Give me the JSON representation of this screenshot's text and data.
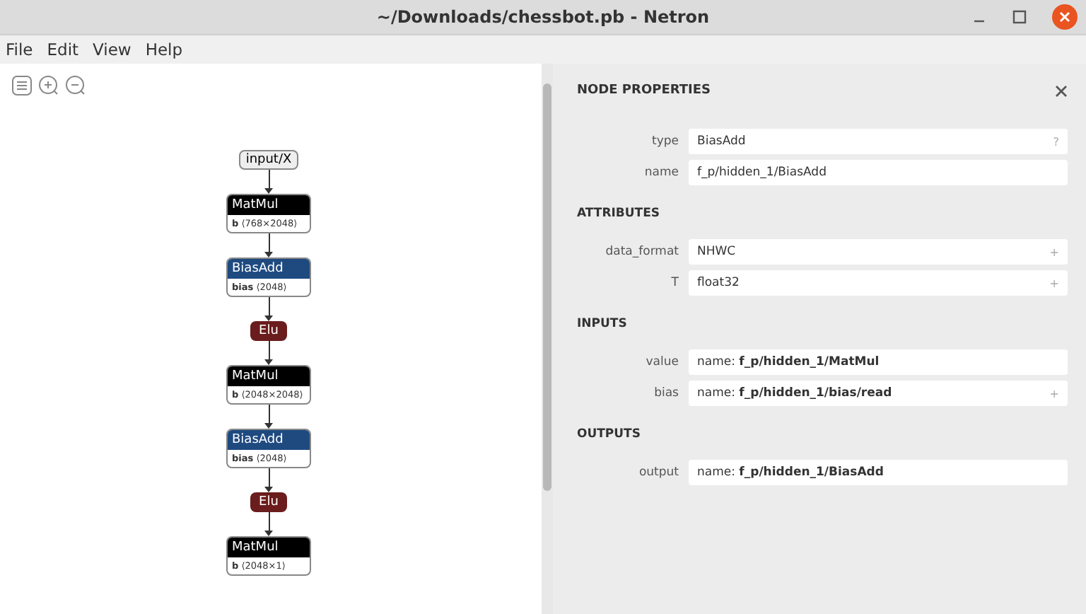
{
  "window": {
    "title": "~/Downloads/chessbot.pb - Netron"
  },
  "menu": [
    {
      "label": "File"
    },
    {
      "label": "Edit"
    },
    {
      "label": "View"
    },
    {
      "label": "Help"
    }
  ],
  "graph": {
    "nodes": [
      {
        "kind": "input",
        "label": "input/X"
      },
      {
        "kind": "op",
        "label": "MatMul",
        "color": "#000000",
        "attr_name": "b",
        "attr_value": "⟨768×2048⟩"
      },
      {
        "kind": "op",
        "label": "BiasAdd",
        "color": "#1e4a80",
        "attr_name": "bias",
        "attr_value": "⟨2048⟩"
      },
      {
        "kind": "activation",
        "label": "Elu",
        "color": "#6b1c1c"
      },
      {
        "kind": "op",
        "label": "MatMul",
        "color": "#000000",
        "attr_name": "b",
        "attr_value": "⟨2048×2048⟩"
      },
      {
        "kind": "op",
        "label": "BiasAdd",
        "color": "#1e4a80",
        "attr_name": "bias",
        "attr_value": "⟨2048⟩"
      },
      {
        "kind": "activation",
        "label": "Elu",
        "color": "#6b1c1c"
      },
      {
        "kind": "op",
        "label": "MatMul",
        "color": "#000000",
        "attr_name": "b",
        "attr_value": "⟨2048×1⟩"
      }
    ]
  },
  "panel": {
    "title": "NODE PROPERTIES",
    "sections": [
      {
        "fields": [
          {
            "label": "type",
            "value": "BiasAdd",
            "marker": "?"
          },
          {
            "label": "name",
            "value": "f_p/hidden_1/BiasAdd"
          }
        ]
      },
      {
        "heading": "ATTRIBUTES",
        "fields": [
          {
            "label": "data_format",
            "value": "NHWC",
            "marker": "+"
          },
          {
            "label": "T",
            "value": "float32",
            "marker": "+"
          }
        ]
      },
      {
        "heading": "INPUTS",
        "fields": [
          {
            "label": "value",
            "value": "name: **f_p/hidden_1/MatMul**"
          },
          {
            "label": "bias",
            "value": "name: **f_p/hidden_1/bias/read**",
            "marker": "+"
          }
        ]
      },
      {
        "heading": "OUTPUTS",
        "fields": [
          {
            "label": "output",
            "value": "name: **f_p/hidden_1/BiasAdd**"
          }
        ]
      }
    ]
  }
}
